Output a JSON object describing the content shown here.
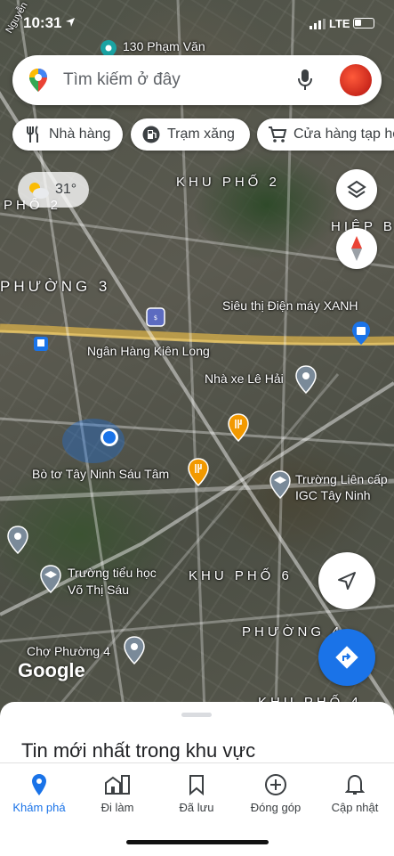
{
  "status_bar": {
    "time": "10:31",
    "network": "LTE"
  },
  "search": {
    "placeholder": "Tìm kiếm ở đây"
  },
  "chips": [
    {
      "label": "Nhà hàng",
      "icon": "restaurant-icon"
    },
    {
      "label": "Trạm xăng",
      "icon": "gas-station-icon"
    },
    {
      "label": "Cửa hàng tạp hóa",
      "icon": "shopping-cart-icon"
    }
  ],
  "weather": {
    "temperature": "31°",
    "icon": "partly-sunny-icon"
  },
  "map": {
    "areas": [
      "KHU PHỐ 2",
      "PHỐ 2",
      "HIỆP B",
      "PHƯỜNG 3",
      "KHU PHỐ 6",
      "PHƯỜNG 4",
      "KHU PHỐ 4"
    ],
    "top_road": "Nguyễn",
    "pois": [
      {
        "name": "130 Phạm Văn"
      },
      {
        "name": "Siêu thị Điện máy XANH"
      },
      {
        "name": "Ngân Hàng Kiên Long"
      },
      {
        "name": "Nhà xe Lê Hải"
      },
      {
        "name": "Bò tơ Tây Ninh Sáu Tâm"
      },
      {
        "name": "Trường Liên cấp IGC Tây Ninh"
      },
      {
        "name": "Trường tiểu học Võ Thị Sáu"
      },
      {
        "name": "Chợ Phường 4"
      }
    ],
    "attribution": "Google"
  },
  "colors": {
    "accent": "#1a73e8",
    "restaurant": "#f29900",
    "red": "#ea4335"
  },
  "sheet": {
    "title": "Tin mới nhất trong khu vực"
  },
  "bottom_nav": [
    {
      "label": "Khám phá",
      "icon": "explore-pin-icon",
      "active": true
    },
    {
      "label": "Đi làm",
      "icon": "commute-icon",
      "active": false
    },
    {
      "label": "Đã lưu",
      "icon": "bookmark-icon",
      "active": false
    },
    {
      "label": "Đóng góp",
      "icon": "add-circle-icon",
      "active": false
    },
    {
      "label": "Cập nhật",
      "icon": "bell-icon",
      "active": false
    }
  ]
}
